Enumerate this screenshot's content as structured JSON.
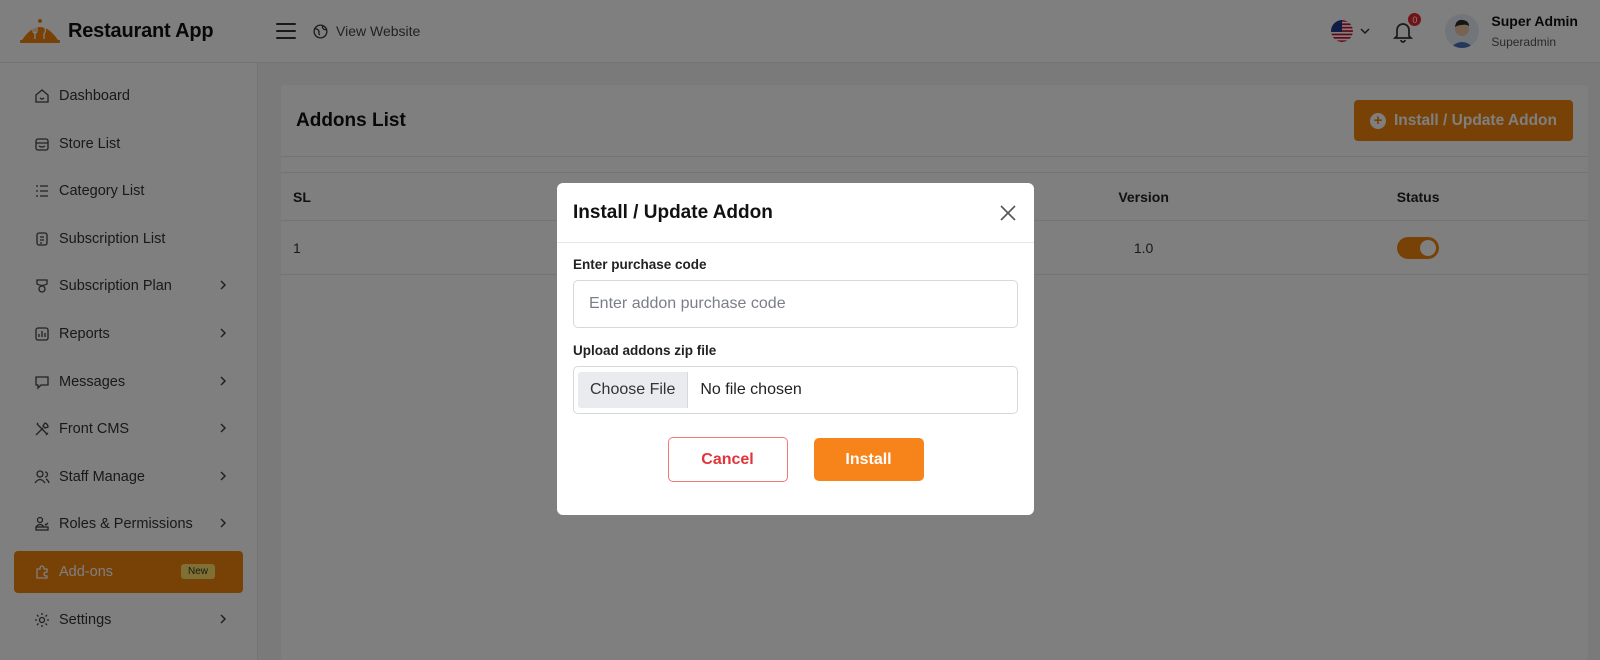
{
  "app": {
    "name": "Restaurant App",
    "view_website": "View Website"
  },
  "header": {
    "notification_count": "0",
    "user_name": "Super Admin",
    "user_role": "Superadmin"
  },
  "sidebar": {
    "items": [
      {
        "label": "Dashboard",
        "icon": "home-icon",
        "has_children": false
      },
      {
        "label": "Store List",
        "icon": "store-icon",
        "has_children": false
      },
      {
        "label": "Category List",
        "icon": "list-icon",
        "has_children": false
      },
      {
        "label": "Subscription List",
        "icon": "clipboard-icon",
        "has_children": false
      },
      {
        "label": "Subscription Plan",
        "icon": "plan-icon",
        "has_children": true
      },
      {
        "label": "Reports",
        "icon": "chart-icon",
        "has_children": true
      },
      {
        "label": "Messages",
        "icon": "message-icon",
        "has_children": true
      },
      {
        "label": "Front CMS",
        "icon": "tools-icon",
        "has_children": true
      },
      {
        "label": "Staff Manage",
        "icon": "users-icon",
        "has_children": true
      },
      {
        "label": "Roles & Permissions",
        "icon": "roles-icon",
        "has_children": true
      },
      {
        "label": "Add-ons",
        "icon": "puzzle-icon",
        "has_children": false,
        "active": true,
        "badge": "New"
      },
      {
        "label": "Settings",
        "icon": "gear-icon",
        "has_children": true
      }
    ]
  },
  "page": {
    "title": "Addons List",
    "install_button": "Install / Update Addon"
  },
  "table": {
    "columns": [
      "SL",
      "Version",
      "Status"
    ],
    "rows": [
      {
        "sl": "1",
        "version": "1.0",
        "status": true
      }
    ]
  },
  "modal": {
    "title": "Install / Update Addon",
    "purchase_label": "Enter purchase code",
    "purchase_placeholder": "Enter addon purchase code",
    "upload_label": "Upload addons zip file",
    "choose_file": "Choose File",
    "no_file": "No file chosen",
    "cancel": "Cancel",
    "install": "Install"
  },
  "colors": {
    "brand": "#f0840e",
    "danger": "#e1343b"
  }
}
